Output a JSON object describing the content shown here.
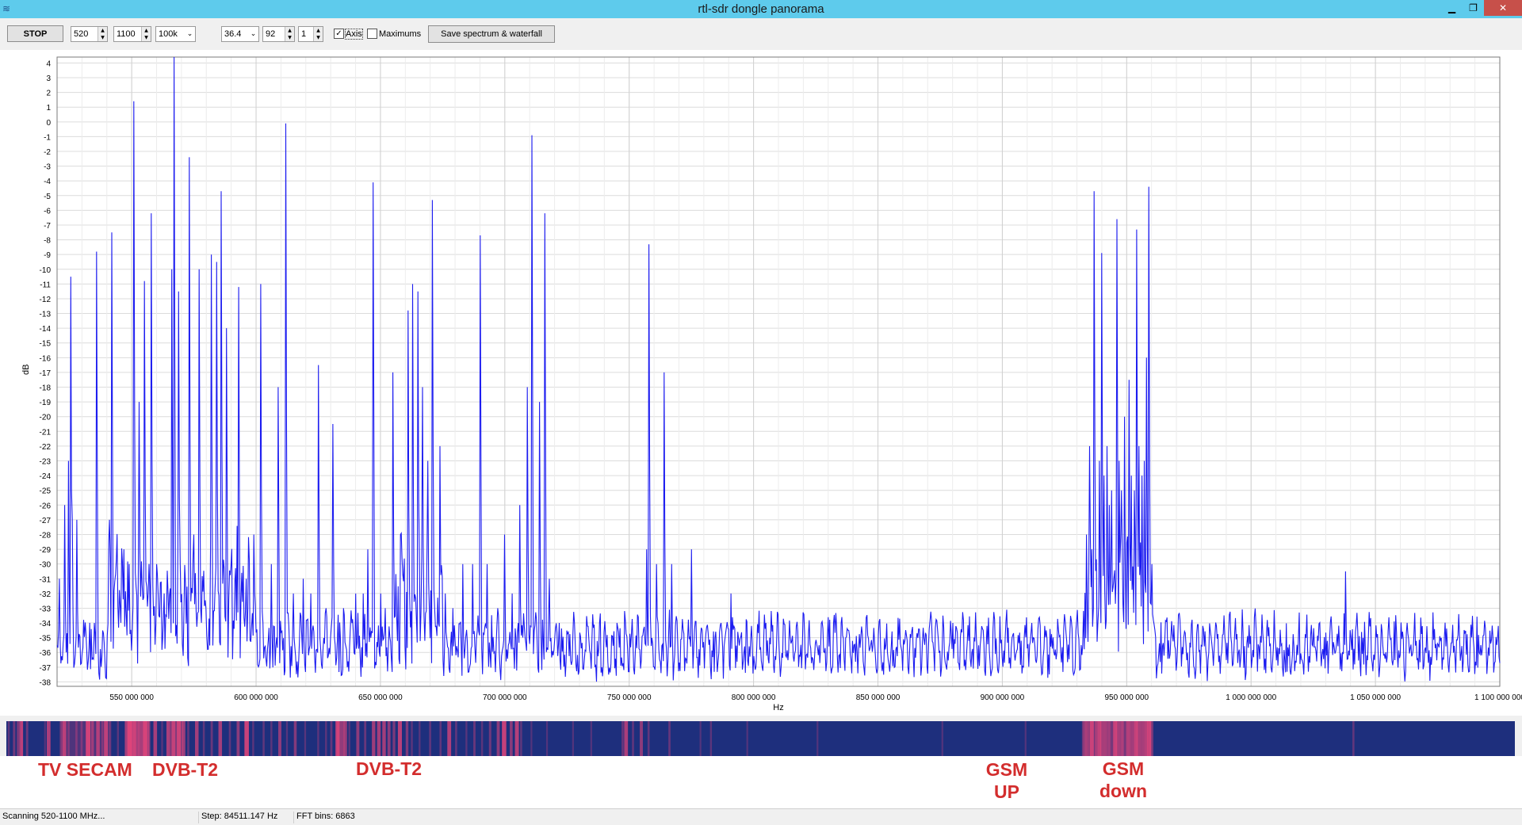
{
  "window": {
    "title": "rtl-sdr dongle panorama"
  },
  "toolbar": {
    "stop_label": "STOP",
    "start_freq": "520",
    "end_freq": "1100",
    "step_value": "100k",
    "gain_value": "36.4",
    "param_value": "92",
    "avg_value": "1",
    "axis_label": "Axis",
    "axis_checked": true,
    "maximums_label": "Maximums",
    "maximums_checked": false,
    "save_label": "Save spectrum & waterfall"
  },
  "chart_data": {
    "type": "line",
    "ylabel": "dB",
    "xlabel": "Hz",
    "xlim": [
      520000000,
      1100000000
    ],
    "ylim": [
      -38,
      4
    ],
    "yticks": [
      4,
      3,
      2,
      1,
      0,
      -1,
      -2,
      -3,
      -4,
      -5,
      -6,
      -7,
      -8,
      -9,
      -10,
      -11,
      -12,
      -13,
      -14,
      -15,
      -16,
      -17,
      -18,
      -19,
      -20,
      -21,
      -22,
      -23,
      -24,
      -25,
      -26,
      -27,
      -28,
      -29,
      -30,
      -31,
      -32,
      -33,
      -34,
      -35,
      -36,
      -37,
      -38
    ],
    "xticks": [
      550000000,
      600000000,
      650000000,
      700000000,
      750000000,
      800000000,
      850000000,
      900000000,
      950000000,
      1000000000,
      1050000000,
      1100000000
    ],
    "xtick_labels": [
      "550 000 000",
      "600 000 000",
      "650 000 000",
      "700 000 000",
      "750 000 000",
      "800 000 000",
      "850 000 000",
      "900 000 000",
      "950 000 000",
      "1 000 000 000",
      "1 050 000 000",
      "1 100 000 000"
    ],
    "grid": true,
    "line_color": "#1c1cf0",
    "noise_floor": -35.5,
    "peaks": [
      {
        "f": 521,
        "db": -31
      },
      {
        "f": 523,
        "db": -26
      },
      {
        "f": 524.5,
        "db": -23
      },
      {
        "f": 526,
        "db": -27
      },
      {
        "f": 525.5,
        "db": -10.5
      },
      {
        "f": 528,
        "db": -27
      },
      {
        "f": 535,
        "db": -34
      },
      {
        "f": 536,
        "db": -8.8
      },
      {
        "f": 541,
        "db": -27
      },
      {
        "f": 542,
        "db": -7.5
      },
      {
        "f": 544,
        "db": -30
      },
      {
        "f": 547,
        "db": -29
      },
      {
        "f": 549,
        "db": -30
      },
      {
        "f": 551,
        "db": 1.4
      },
      {
        "f": 553,
        "db": -19
      },
      {
        "f": 555,
        "db": -10.8
      },
      {
        "f": 557,
        "db": -30
      },
      {
        "f": 558,
        "db": -6.2
      },
      {
        "f": 560,
        "db": -30
      },
      {
        "f": 563,
        "db": -32
      },
      {
        "f": 566,
        "db": -10
      },
      {
        "f": 567,
        "db": 4.4
      },
      {
        "f": 569,
        "db": -11.5
      },
      {
        "f": 571,
        "db": -33
      },
      {
        "f": 573,
        "db": -2.4
      },
      {
        "f": 575,
        "db": -28
      },
      {
        "f": 577,
        "db": -10
      },
      {
        "f": 580,
        "db": -33
      },
      {
        "f": 582,
        "db": -9
      },
      {
        "f": 584,
        "db": -9.5
      },
      {
        "f": 586,
        "db": -4.7
      },
      {
        "f": 588,
        "db": -14
      },
      {
        "f": 590,
        "db": -30
      },
      {
        "f": 593,
        "db": -11.2
      },
      {
        "f": 596,
        "db": -31
      },
      {
        "f": 599,
        "db": -28
      },
      {
        "f": 602,
        "db": -11
      },
      {
        "f": 606,
        "db": -30
      },
      {
        "f": 609,
        "db": -18
      },
      {
        "f": 612,
        "db": -0.1
      },
      {
        "f": 615,
        "db": -32
      },
      {
        "f": 619,
        "db": -31
      },
      {
        "f": 622,
        "db": -32
      },
      {
        "f": 625,
        "db": -16.5
      },
      {
        "f": 628,
        "db": -33
      },
      {
        "f": 631,
        "db": -20.5
      },
      {
        "f": 635,
        "db": -33
      },
      {
        "f": 640,
        "db": -32
      },
      {
        "f": 643,
        "db": -32
      },
      {
        "f": 645,
        "db": -29
      },
      {
        "f": 647,
        "db": -4.1
      },
      {
        "f": 650,
        "db": -32
      },
      {
        "f": 652,
        "db": -33
      },
      {
        "f": 655,
        "db": -17
      },
      {
        "f": 658,
        "db": -28
      },
      {
        "f": 661,
        "db": -12.8
      },
      {
        "f": 663,
        "db": -11
      },
      {
        "f": 665,
        "db": -11.5
      },
      {
        "f": 667,
        "db": -18
      },
      {
        "f": 669,
        "db": -23
      },
      {
        "f": 671,
        "db": -5.3
      },
      {
        "f": 674,
        "db": -22
      },
      {
        "f": 676,
        "db": -32
      },
      {
        "f": 679,
        "db": -33
      },
      {
        "f": 683,
        "db": -30
      },
      {
        "f": 687,
        "db": -30
      },
      {
        "f": 690,
        "db": -7.7
      },
      {
        "f": 693,
        "db": -30
      },
      {
        "f": 697,
        "db": -33
      },
      {
        "f": 700,
        "db": -28
      },
      {
        "f": 703,
        "db": -32
      },
      {
        "f": 706,
        "db": -26
      },
      {
        "f": 709,
        "db": -18
      },
      {
        "f": 711,
        "db": -0.9
      },
      {
        "f": 714,
        "db": -19
      },
      {
        "f": 716,
        "db": -6.2
      },
      {
        "f": 718,
        "db": -31
      },
      {
        "f": 722,
        "db": -34
      },
      {
        "f": 728,
        "db": -34
      },
      {
        "f": 738,
        "db": -34
      },
      {
        "f": 745,
        "db": -34
      },
      {
        "f": 757,
        "db": -29
      },
      {
        "f": 758,
        "db": -8.3
      },
      {
        "f": 761,
        "db": -30
      },
      {
        "f": 764,
        "db": -17
      },
      {
        "f": 767,
        "db": -30
      },
      {
        "f": 775,
        "db": -29
      },
      {
        "f": 787,
        "db": -34
      },
      {
        "f": 791,
        "db": -32
      },
      {
        "f": 805,
        "db": -34
      },
      {
        "f": 832,
        "db": -34
      },
      {
        "f": 880,
        "db": -34
      },
      {
        "f": 912,
        "db": -34
      },
      {
        "f": 934,
        "db": -28
      },
      {
        "f": 935,
        "db": -22
      },
      {
        "f": 936,
        "db": -29
      },
      {
        "f": 937,
        "db": -4.7
      },
      {
        "f": 939,
        "db": -23
      },
      {
        "f": 940,
        "db": -8.9
      },
      {
        "f": 941,
        "db": -24
      },
      {
        "f": 942,
        "db": -22
      },
      {
        "f": 943,
        "db": -26
      },
      {
        "f": 944,
        "db": -25
      },
      {
        "f": 946,
        "db": -6.6
      },
      {
        "f": 947,
        "db": -23
      },
      {
        "f": 948,
        "db": -25
      },
      {
        "f": 949,
        "db": -20
      },
      {
        "f": 951,
        "db": -17.5
      },
      {
        "f": 952,
        "db": -24
      },
      {
        "f": 953,
        "db": -25
      },
      {
        "f": 954,
        "db": -7.3
      },
      {
        "f": 955,
        "db": -22
      },
      {
        "f": 956,
        "db": -24
      },
      {
        "f": 957,
        "db": -23
      },
      {
        "f": 958,
        "db": -16
      },
      {
        "f": 959,
        "db": -4.4
      },
      {
        "f": 960,
        "db": -30
      },
      {
        "f": 1038,
        "db": -30.5
      }
    ]
  },
  "annotations": [
    {
      "text": "TV SECAM"
    },
    {
      "text": "DVB-T2"
    },
    {
      "text": "DVB-T2"
    },
    {
      "text": "GSM\nUP"
    },
    {
      "text": "GSM\ndown"
    }
  ],
  "status": {
    "scan": "Scanning 520-1100 MHz...",
    "step": "Step: 84511.147 Hz",
    "bins": "FFT bins: 6863"
  },
  "colors": {
    "titlebar": "#5ecbec",
    "waterfall_base": "#1e2f7d",
    "waterfall_hot": "#e0457a",
    "annotation": "#d32d2d"
  }
}
